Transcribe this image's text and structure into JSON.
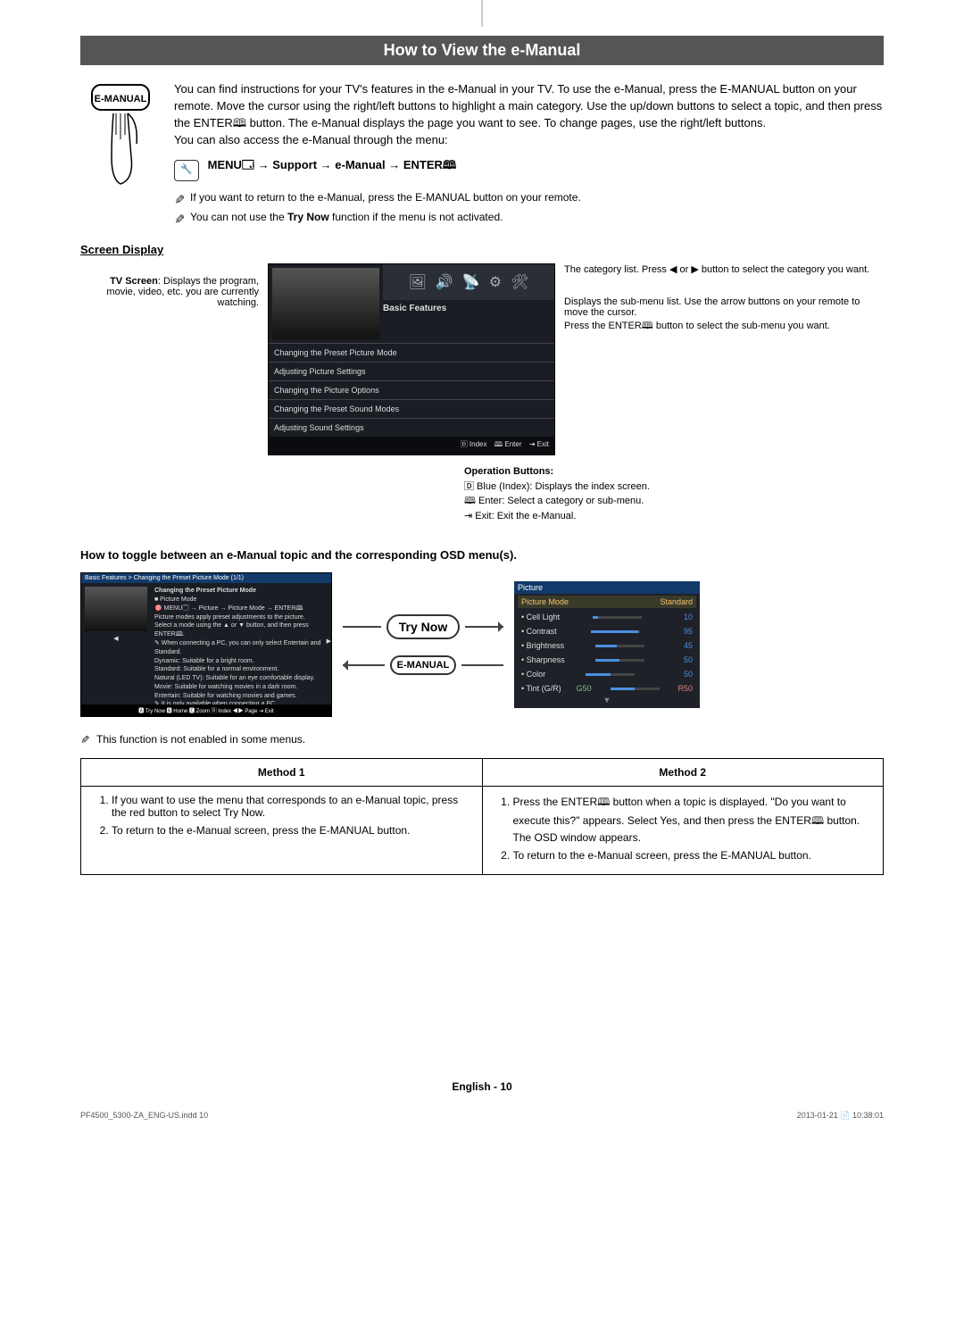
{
  "title": "How to View the e-Manual",
  "remote_button_label": "E-MANUAL",
  "intro": {
    "p1": "You can find instructions for your TV's features in the e-Manual in your TV. To use the e-Manual, press the E-MANUAL button on your remote. Move the cursor using the right/left buttons to highlight a main category. Use the up/down buttons to select a topic, and then press the ENTER🕮 button. The e-Manual displays the page you want to see. To change pages, use the right/left buttons.",
    "p2": "You can also access the e-Manual through the menu:",
    "menu_path": "MENU🗔 → Support → e-Manual → ENTER🕮",
    "note1": "If you want to return to the e-Manual, press the E-MANUAL button on your remote.",
    "note2_a": "You can not use the ",
    "note2_b": "Try Now",
    "note2_c": " function if the menu is not activated."
  },
  "screen_display_heading": "Screen Display",
  "screen_display": {
    "tv_screen": "TV Screen: Displays the program, movie, video, etc. you are currently watching.",
    "category_list": "The category list. Press ◀ or ▶ button to select the category you want.",
    "submenu": "Displays the sub-menu list. Use the arrow buttons on your remote to move the cursor.",
    "submenu2": "Press the ENTER🕮 button to select the sub-menu you want.",
    "tab_label": "Basic Features",
    "rows": [
      "Changing the Preset Picture Mode",
      "Adjusting Picture Settings",
      "Changing the Picture Options",
      "Changing the Preset Sound Modes",
      "Adjusting Sound Settings"
    ],
    "bottom_bar": {
      "index": "🄳 Index",
      "enter": "🕮 Enter",
      "exit": "⇥ Exit"
    }
  },
  "operation_buttons": {
    "heading": "Operation Buttons:",
    "blue": "🄳 Blue (Index): Displays the index screen.",
    "enter": "🕮 Enter: Select a category or sub-menu.",
    "exit": "⇥ Exit: Exit the e-Manual."
  },
  "toggle_heading": "How to toggle between an e-Manual topic and the corresponding OSD menu(s).",
  "manual_screen": {
    "header": "Basic Features > Changing the Preset Picture Mode (1/1)",
    "h2": "Changing the Preset Picture Mode",
    "h3": "■ Picture Mode",
    "path": "🎯 MENU🗔 → Picture → Picture Mode → ENTER🕮",
    "desc": "Picture modes apply preset adjustments to the picture. Select a mode using the ▲ or ▼ button, and then press ENTER🕮.",
    "hint": "✎ When connecting a PC, you can only select Entertain and Standard.",
    "bullets": [
      "Dynamic: Suitable for a bright room.",
      "Standard: Suitable for a normal environment.",
      "Natural (LED TV): Suitable for an eye comfortable display.",
      "Movie: Suitable for watching movies in a dark room.",
      "Entertain: Suitable for watching movies and games."
    ],
    "subhint": "✎ It is only available when connecting a PC.",
    "foot": "🅰 Try Now  🅱 Home  🅲 Zoom  🄳 Index  ◀▶ Page  ⇥ Exit"
  },
  "arrow_buttons": {
    "try_now": "Try Now",
    "emanual": "E-MANUAL"
  },
  "picture_panel": {
    "title": "Picture",
    "mode_label": "Picture Mode",
    "mode_value": "Standard",
    "rows": [
      {
        "label": "• Cell Light",
        "value": "10",
        "pct": 10
      },
      {
        "label": "• Contrast",
        "value": "95",
        "pct": 95
      },
      {
        "label": "• Brightness",
        "value": "45",
        "pct": 45
      },
      {
        "label": "• Sharpness",
        "value": "50",
        "pct": 50
      },
      {
        "label": "• Color",
        "value": "50",
        "pct": 50
      }
    ],
    "tint_label": "• Tint (G/R)",
    "tint_g": "G50",
    "tint_r": "R50"
  },
  "note_standalone": "This function is not enabled in some menus.",
  "methods": {
    "h1": "Method 1",
    "h2": "Method 2",
    "m1": [
      "If you want to use the menu that corresponds to an e-Manual topic, press the red button to select Try Now.",
      "To return to the e-Manual screen, press the E-MANUAL button."
    ],
    "m2": [
      "Press the ENTER🕮 button when a topic is displayed. \"Do you want to execute this?\" appears. Select Yes, and then press the ENTER🕮 button. The OSD window appears.",
      "To return to the e-Manual screen, press the E-MANUAL button."
    ]
  },
  "footer": "English - 10",
  "print": {
    "left": "PF4500_5300-ZA_ENG-US.indd   10",
    "right": "2013-01-21  📄 10:38:01"
  }
}
